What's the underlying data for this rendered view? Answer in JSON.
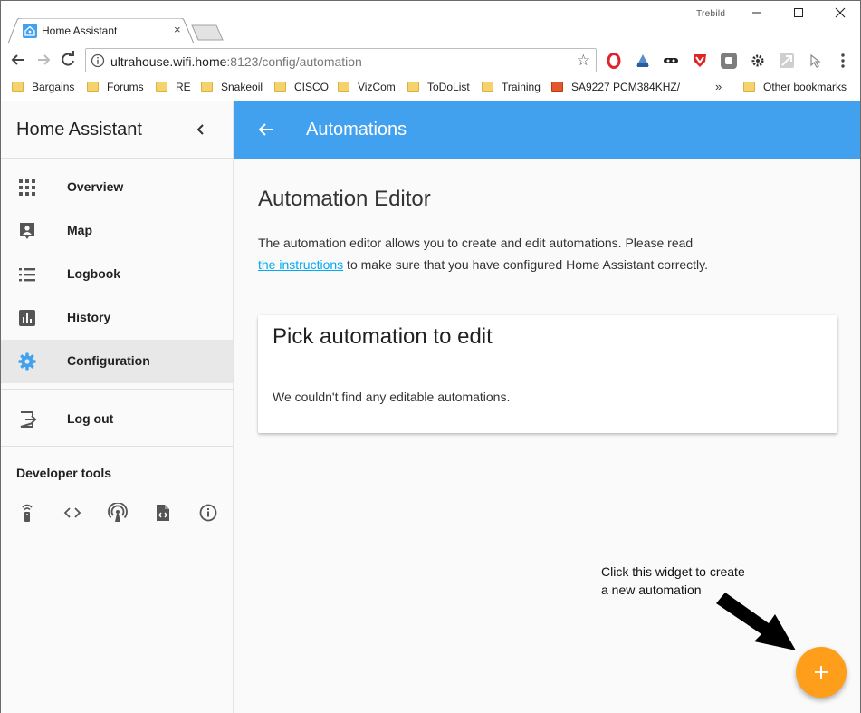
{
  "browser": {
    "tab_title": "Home Assistant",
    "tab_close": "×",
    "profile_name": "Trebild",
    "url_host": "ultrahouse.wifi.home",
    "url_path": ":8123/config/automation",
    "star": "☆",
    "window_controls": [
      "—",
      "☐",
      "✕"
    ],
    "bookmarks": [
      "Bargains",
      "Forums",
      "RE",
      "Snakeoil",
      "CISCO",
      "VizCom",
      "ToDoList",
      "Training",
      "SA9227 PCM384KHZ/"
    ],
    "bookmarks_overflow": "»",
    "other_bookmarks": "Other bookmarks",
    "extension_icons": [
      "opera-icon",
      "sky-icon",
      "incognito-mask-icon",
      "shield-icon",
      "puzzle-icon",
      "gear-extension-icon",
      "user-icon",
      "cursor-icon"
    ]
  },
  "sidebar": {
    "title": "Home Assistant",
    "items": [
      {
        "label": "Overview",
        "icon": "apps-grid-icon"
      },
      {
        "label": "Map",
        "icon": "map-pin-icon"
      },
      {
        "label": "Logbook",
        "icon": "list-icon"
      },
      {
        "label": "History",
        "icon": "chart-icon"
      },
      {
        "label": "Configuration",
        "icon": "gear-icon",
        "active": true
      },
      {
        "label": "Log out",
        "icon": "logout-icon"
      }
    ],
    "developer_tools_title": "Developer tools",
    "developer_tools": [
      "remote-icon",
      "code-icon",
      "broadcast-icon",
      "file-code-icon",
      "info-icon"
    ]
  },
  "header": {
    "title": "Automations"
  },
  "editor": {
    "title": "Automation Editor",
    "desc_before": "The automation editor allows you to create and edit automations. Please read",
    "link_text": "the instructions",
    "desc_after": " to make sure that you have configured Home Assistant correctly."
  },
  "card": {
    "title": "Pick automation to edit",
    "empty_text": "We couldn't find any editable automations."
  },
  "annotation": {
    "line1": "Click this widget to create",
    "line2": "a new automation"
  },
  "colors": {
    "appbar": "#41a1ee",
    "fab": "#ff9e1a",
    "active_icon": "#41a1ee",
    "link": "#03a9f4"
  }
}
